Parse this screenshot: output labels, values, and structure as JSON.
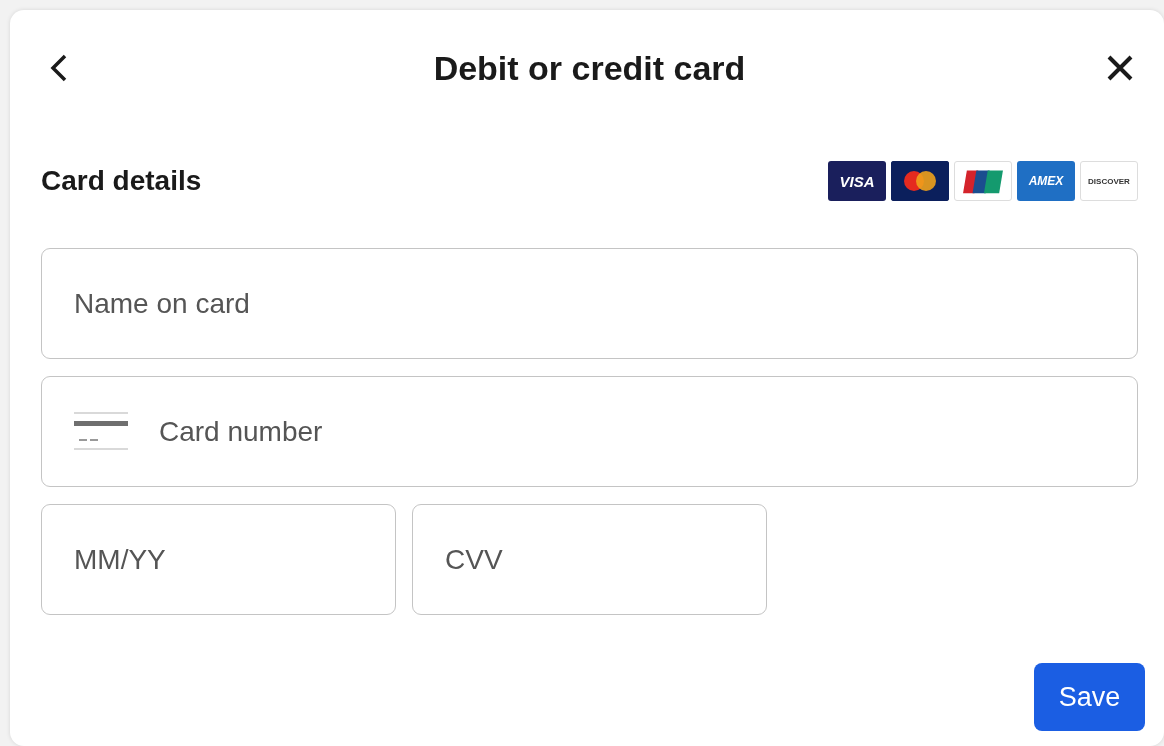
{
  "dialog": {
    "title": "Debit or credit card"
  },
  "card_details": {
    "heading": "Card details",
    "brands": [
      {
        "kind": "visa",
        "label": "VISA"
      },
      {
        "kind": "mastercard"
      },
      {
        "kind": "unionpay"
      },
      {
        "kind": "amex",
        "label": "AMEX"
      },
      {
        "kind": "discover",
        "label": "DISCOVER"
      }
    ]
  },
  "fields": [
    {
      "kind": "name",
      "placeholder": "Name on card"
    },
    {
      "kind": "card",
      "placeholder": "Card number"
    },
    {
      "kind": "expiry",
      "placeholder": "MM/YY"
    },
    {
      "kind": "cvv",
      "placeholder": "CVV"
    }
  ],
  "buttons": [
    {
      "label": "Save"
    }
  ]
}
